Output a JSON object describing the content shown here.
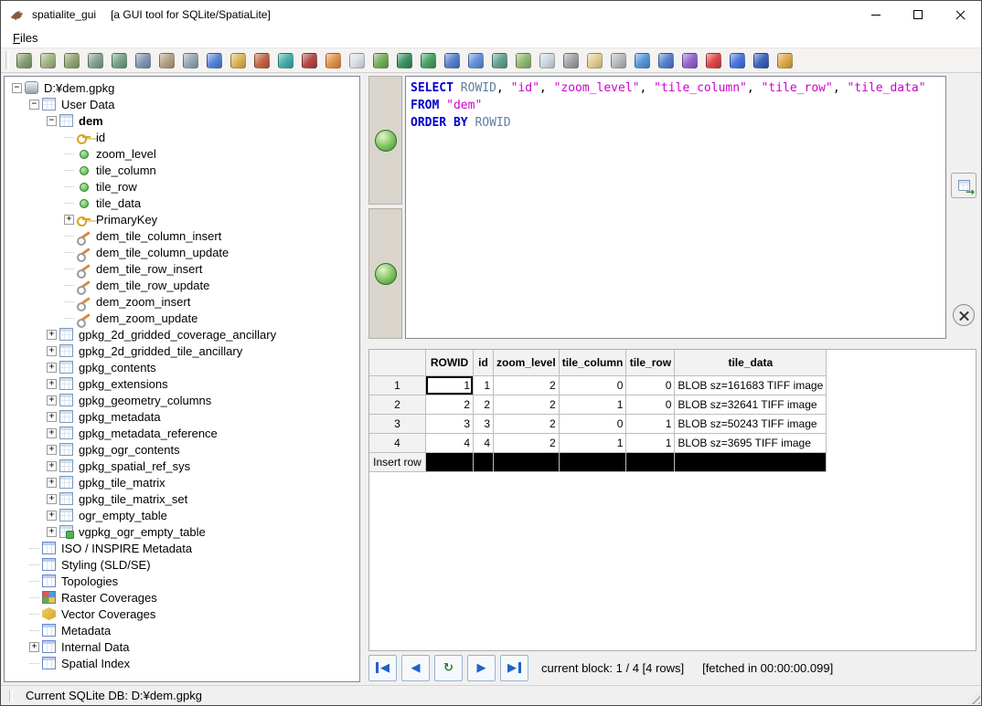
{
  "window": {
    "title": "spatialite_gui",
    "subtitle": "[a GUI tool for SQLite/SpatiaLite]"
  },
  "menu": {
    "files_accel": "F",
    "files_rest": "iles"
  },
  "toolbar": {
    "icons": [
      {
        "name": "connect-db",
        "color": "#7d9b6a"
      },
      {
        "name": "create-db",
        "color": "#9bb07a"
      },
      {
        "name": "disconnect-db",
        "color": "#8aa06a"
      },
      {
        "name": "memory-db",
        "color": "#7d9b8a"
      },
      {
        "name": "load-memory-db",
        "color": "#6a9b7d"
      },
      {
        "name": "save-memory-db",
        "color": "#7a8fb0"
      },
      {
        "name": "clone-db",
        "color": "#b09a7a"
      },
      {
        "name": "attach-db",
        "color": "#8fa0b0"
      },
      {
        "name": "sql-script",
        "color": "#4a7dd6"
      },
      {
        "name": "query-composer",
        "color": "#d6b04a"
      },
      {
        "name": "vacuum-db",
        "color": "#c05a3a"
      },
      {
        "name": "map-preview",
        "color": "#3aa6a6"
      },
      {
        "name": "network",
        "color": "#b03a3a"
      },
      {
        "name": "srid-search",
        "color": "#e08a3a"
      },
      {
        "name": "load-shapefile",
        "color": "#d6dde6"
      },
      {
        "name": "virtual-shapefile",
        "color": "#6aa84f"
      },
      {
        "name": "load-dxf",
        "color": "#2e8b57"
      },
      {
        "name": "virtual-dxf",
        "color": "#3a9b57"
      },
      {
        "name": "load-txt-csv",
        "color": "#4a78c9"
      },
      {
        "name": "virtual-txt-csv",
        "color": "#5a88d9"
      },
      {
        "name": "load-dbf",
        "color": "#5a9a8a"
      },
      {
        "name": "virtual-dbf",
        "color": "#8ab46a"
      },
      {
        "name": "load-xlsx",
        "color": "#c9d4e0"
      },
      {
        "name": "wfs-catalog",
        "color": "#9a9aa0"
      },
      {
        "name": "dump-shapefile",
        "color": "#e0c98a"
      },
      {
        "name": "sql-log",
        "color": "#b0b4b8"
      },
      {
        "name": "search-entity",
        "color": "#4a90d9"
      },
      {
        "name": "tools",
        "color": "#4a78c9"
      },
      {
        "name": "language",
        "color": "#8a5ac9"
      },
      {
        "name": "charset",
        "color": "#d93b3b"
      },
      {
        "name": "help",
        "color": "#3b6bd9"
      },
      {
        "name": "about",
        "color": "#2f58b8"
      },
      {
        "name": "exit",
        "color": "#d9a43b"
      }
    ]
  },
  "tree": {
    "nodes": [
      {
        "label": "D:¥dem.gpkg",
        "level": 0,
        "icon": "db",
        "exp": "m"
      },
      {
        "label": "User Data",
        "level": 1,
        "icon": "table",
        "exp": "m"
      },
      {
        "label": "dem",
        "level": 2,
        "icon": "table",
        "exp": "m",
        "bold": true
      },
      {
        "label": "id",
        "level": 3,
        "icon": "key"
      },
      {
        "label": "zoom_level",
        "level": 3,
        "icon": "dot"
      },
      {
        "label": "tile_column",
        "level": 3,
        "icon": "dot"
      },
      {
        "label": "tile_row",
        "level": 3,
        "icon": "dot"
      },
      {
        "label": "tile_data",
        "level": 3,
        "icon": "dot"
      },
      {
        "label": "PrimaryKey",
        "level": 3,
        "icon": "pkey",
        "exp": "p"
      },
      {
        "label": "dem_tile_column_insert",
        "level": 3,
        "icon": "trigger"
      },
      {
        "label": "dem_tile_column_update",
        "level": 3,
        "icon": "trigger"
      },
      {
        "label": "dem_tile_row_insert",
        "level": 3,
        "icon": "trigger"
      },
      {
        "label": "dem_tile_row_update",
        "level": 3,
        "icon": "trigger"
      },
      {
        "label": "dem_zoom_insert",
        "level": 3,
        "icon": "trigger"
      },
      {
        "label": "dem_zoom_update",
        "level": 3,
        "icon": "trigger"
      },
      {
        "label": "gpkg_2d_gridded_coverage_ancillary",
        "level": 2,
        "icon": "table",
        "exp": "p"
      },
      {
        "label": "gpkg_2d_gridded_tile_ancillary",
        "level": 2,
        "icon": "table",
        "exp": "p"
      },
      {
        "label": "gpkg_contents",
        "level": 2,
        "icon": "table",
        "exp": "p"
      },
      {
        "label": "gpkg_extensions",
        "level": 2,
        "icon": "table",
        "exp": "p"
      },
      {
        "label": "gpkg_geometry_columns",
        "level": 2,
        "icon": "table",
        "exp": "p"
      },
      {
        "label": "gpkg_metadata",
        "level": 2,
        "icon": "table",
        "exp": "p"
      },
      {
        "label": "gpkg_metadata_reference",
        "level": 2,
        "icon": "table",
        "exp": "p"
      },
      {
        "label": "gpkg_ogr_contents",
        "level": 2,
        "icon": "table",
        "exp": "p"
      },
      {
        "label": "gpkg_spatial_ref_sys",
        "level": 2,
        "icon": "table",
        "exp": "p"
      },
      {
        "label": "gpkg_tile_matrix",
        "level": 2,
        "icon": "table",
        "exp": "p"
      },
      {
        "label": "gpkg_tile_matrix_set",
        "level": 2,
        "icon": "table",
        "exp": "p"
      },
      {
        "label": "ogr_empty_table",
        "level": 2,
        "icon": "table",
        "exp": "p"
      },
      {
        "label": "vgpkg_ogr_empty_table",
        "level": 2,
        "icon": "vtable",
        "exp": "p"
      },
      {
        "label": "ISO / INSPIRE Metadata",
        "level": 1,
        "icon": "meta"
      },
      {
        "label": "Styling (SLD/SE)",
        "level": 1,
        "icon": "meta"
      },
      {
        "label": "Topologies",
        "level": 1,
        "icon": "meta"
      },
      {
        "label": "Raster Coverages",
        "level": 1,
        "icon": "raster"
      },
      {
        "label": "Vector Coverages",
        "level": 1,
        "icon": "vector"
      },
      {
        "label": "Metadata",
        "level": 1,
        "icon": "meta"
      },
      {
        "label": "Internal Data",
        "level": 1,
        "icon": "meta",
        "exp": "p"
      },
      {
        "label": "Spatial Index",
        "level": 1,
        "icon": "meta"
      }
    ]
  },
  "sql": {
    "lines": [
      [
        [
          "k",
          "SELECT"
        ],
        [
          "t",
          " "
        ],
        [
          "r",
          "ROWID"
        ],
        [
          "t",
          ", "
        ],
        [
          "s",
          "\"id\""
        ],
        [
          "t",
          ", "
        ],
        [
          "s",
          "\"zoom_level\""
        ],
        [
          "t",
          ", "
        ],
        [
          "s",
          "\"tile_column\""
        ],
        [
          "t",
          ", "
        ],
        [
          "s",
          "\"tile_row\""
        ],
        [
          "t",
          ", "
        ],
        [
          "s",
          "\"tile_data\""
        ]
      ],
      [
        [
          "k",
          "FROM"
        ],
        [
          "t",
          " "
        ],
        [
          "s",
          "\"dem\""
        ]
      ],
      [
        [
          "k",
          "ORDER BY"
        ],
        [
          "t",
          " "
        ],
        [
          "r",
          "ROWID"
        ]
      ]
    ]
  },
  "results": {
    "headers": [
      "ROWID",
      "id",
      "zoom_level",
      "tile_column",
      "tile_row",
      "tile_data"
    ],
    "rows": [
      {
        "label": "1",
        "cells": [
          "1",
          "1",
          "2",
          "0",
          "0",
          "BLOB sz=161683 TIFF image"
        ]
      },
      {
        "label": "2",
        "cells": [
          "2",
          "2",
          "2",
          "1",
          "0",
          "BLOB sz=32641 TIFF image"
        ]
      },
      {
        "label": "3",
        "cells": [
          "3",
          "3",
          "2",
          "0",
          "1",
          "BLOB sz=50243 TIFF image"
        ]
      },
      {
        "label": "4",
        "cells": [
          "4",
          "4",
          "2",
          "1",
          "1",
          "BLOB sz=3695 TIFF image"
        ]
      }
    ],
    "insert_label": "Insert row",
    "selected_cell": {
      "row": 0,
      "col": 0
    },
    "nav": [
      {
        "name": "first-row-button",
        "glyph": "◀",
        "bar": "left",
        "color": "#1e62c9"
      },
      {
        "name": "previous-block-button",
        "glyph": "◀",
        "color": "#1e62c9"
      },
      {
        "name": "refresh-rowset-button",
        "glyph": "↻",
        "color": "#2e7d32"
      },
      {
        "name": "next-block-button",
        "glyph": "▶",
        "color": "#1e62c9"
      },
      {
        "name": "last-row-button",
        "glyph": "▶",
        "bar": "right",
        "color": "#1e62c9"
      }
    ],
    "status": "current block: 1 / 4 [4 rows]",
    "fetched": "[fetched in 00:00:00.099]"
  },
  "statusbar": {
    "text": "Current SQLite DB: D:¥dem.gpkg"
  }
}
